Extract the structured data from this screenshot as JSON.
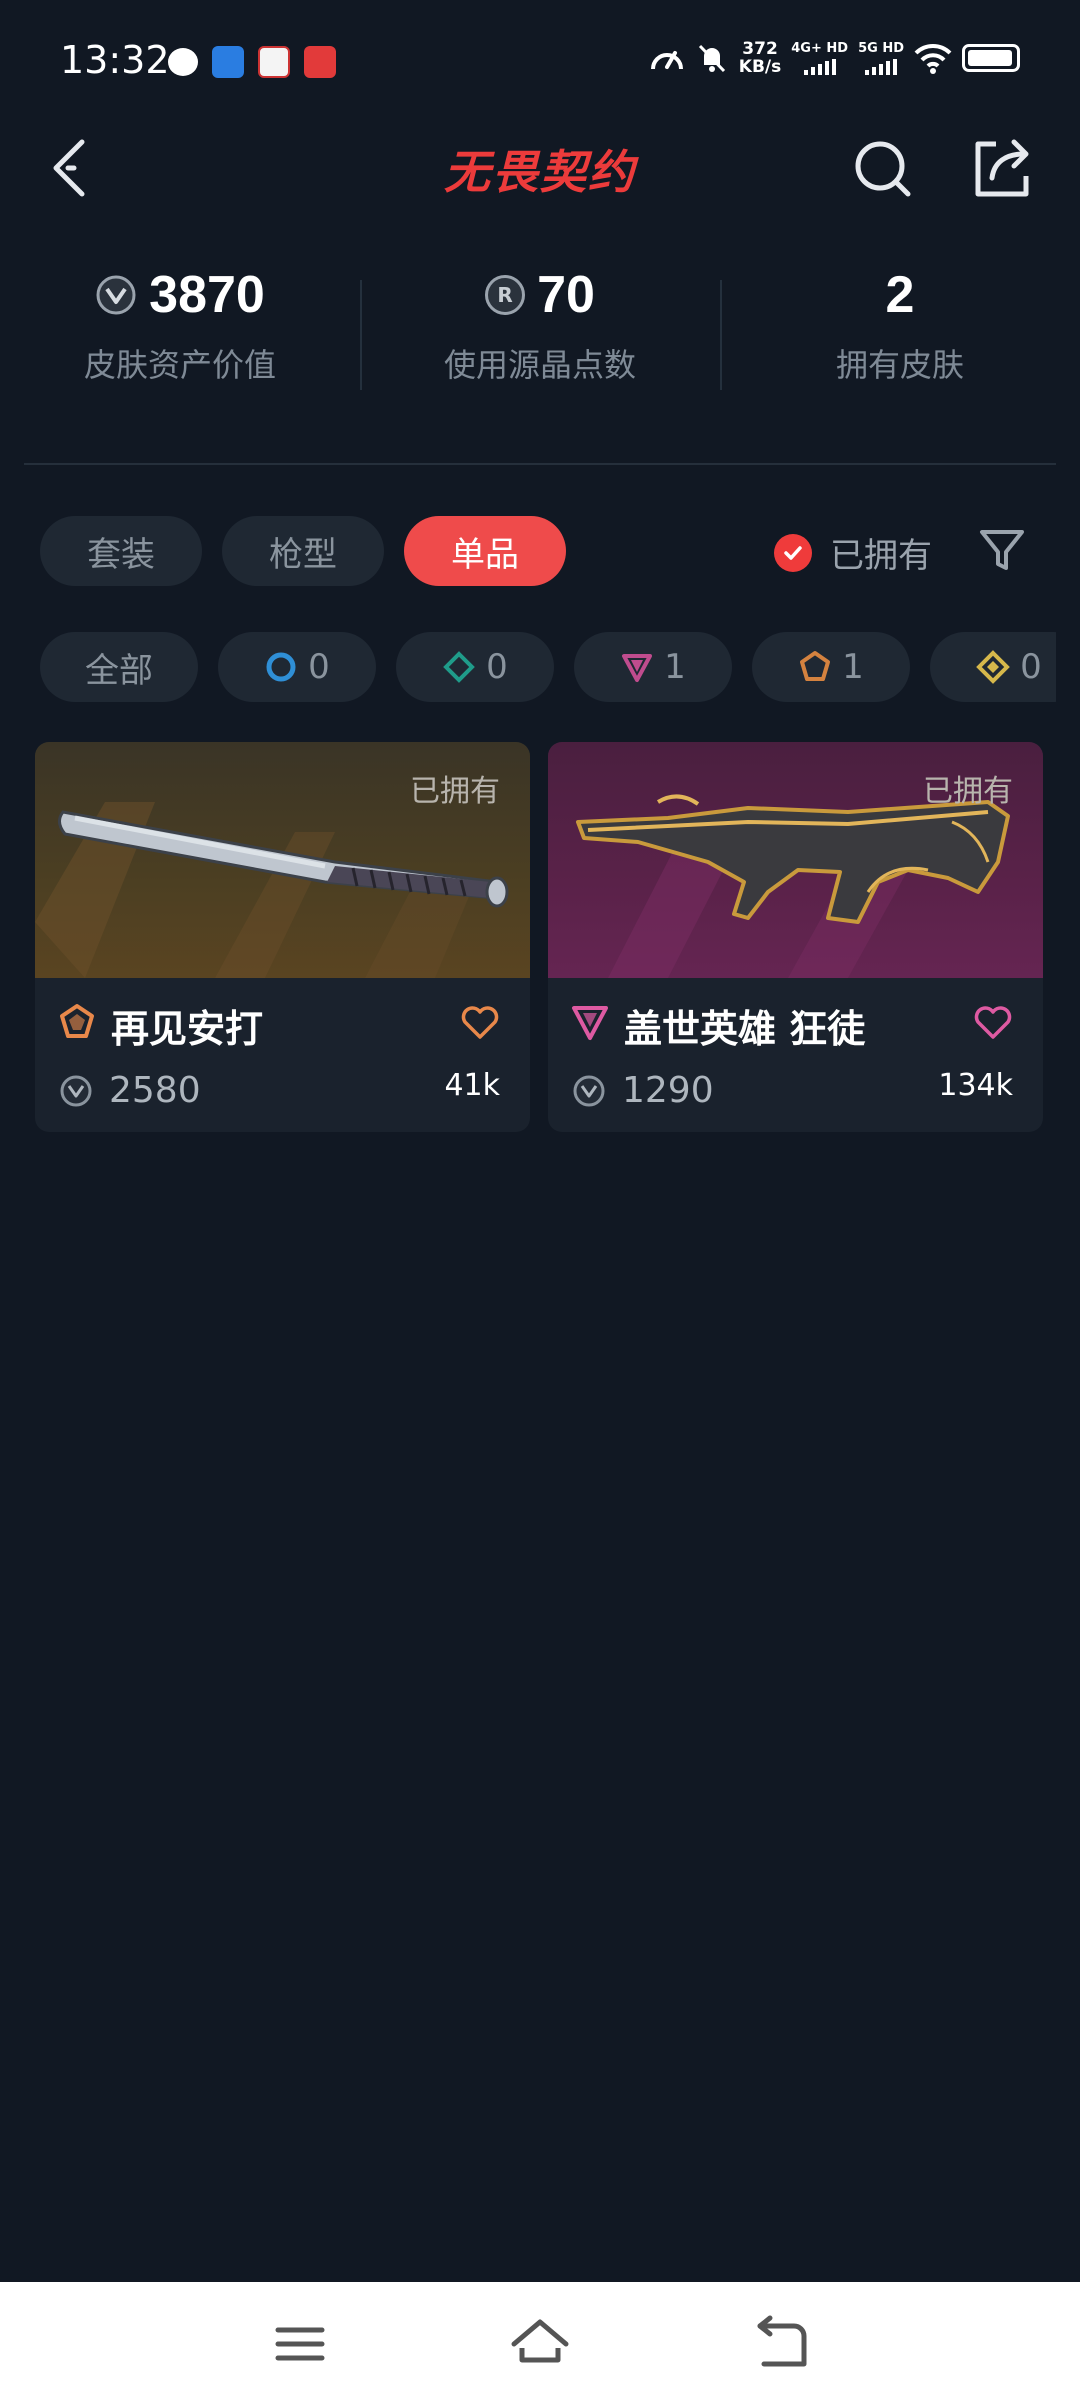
{
  "status_bar": {
    "time": "13:32",
    "net_speed_value": "372",
    "net_speed_unit": "KB/s",
    "signal1": "4G+ HD",
    "signal2": "5G HD"
  },
  "header": {
    "title": "无畏契约",
    "icons": [
      "back-icon",
      "search-icon",
      "share-icon"
    ]
  },
  "stats": [
    {
      "value": "3870",
      "label": "皮肤资产价值",
      "icon": "vp-coin-icon"
    },
    {
      "value": "70",
      "label": "使用源晶点数",
      "icon": "radianite-icon",
      "icon_text": "R"
    },
    {
      "value": "2",
      "label": "拥有皮肤"
    }
  ],
  "tabs": [
    {
      "label": "套装",
      "active": false
    },
    {
      "label": "枪型",
      "active": false
    },
    {
      "label": "单品",
      "active": true
    }
  ],
  "owned_filter": {
    "label": "已拥有",
    "checked": true
  },
  "rarity_chips": [
    {
      "label": "全部"
    },
    {
      "count": "0",
      "icon": "select-edition-icon",
      "color": "#2f8fd6"
    },
    {
      "count": "0",
      "icon": "deluxe-edition-icon",
      "color": "#1f9c8a"
    },
    {
      "count": "1",
      "icon": "premium-edition-icon",
      "color": "#c04c8e"
    },
    {
      "count": "1",
      "icon": "exclusive-edition-icon",
      "color": "#d4823f"
    },
    {
      "count": "0",
      "icon": "ultra-edition-icon",
      "color": "#d6b84b"
    }
  ],
  "cards": [
    {
      "name": "再见安打",
      "owned_tag": "已拥有",
      "price": "2580",
      "likes": "41k",
      "rarity_color": "#e8884a",
      "heart_color": "#e8884a"
    },
    {
      "name": "盖世英雄 狂徒",
      "owned_tag": "已拥有",
      "price": "1290",
      "likes": "134k",
      "rarity_color": "#de5aa2",
      "heart_color": "#de5aa2"
    }
  ],
  "colors": {
    "background": "#111823",
    "accent": "#ef4b4b",
    "chip_bg": "#1f2833"
  }
}
